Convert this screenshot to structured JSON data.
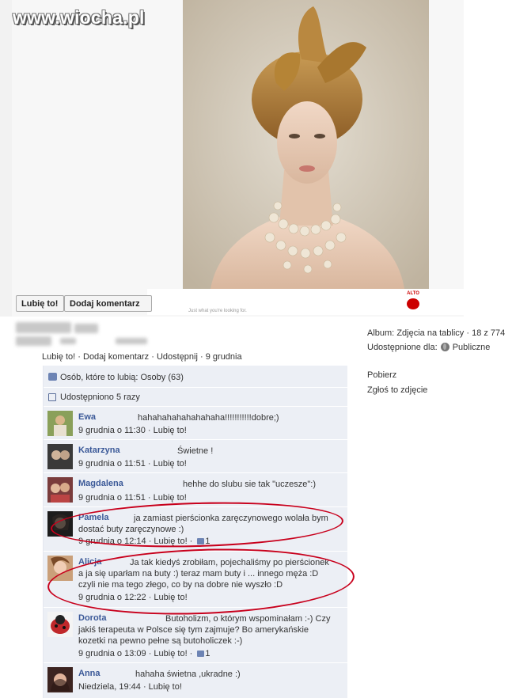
{
  "watermark": "www.wiocha.pl",
  "photo": {
    "tagline": "Just what you're looking for.",
    "brand": "ALTO"
  },
  "buttons": {
    "like": "Lubię to!",
    "comment": "Dodaj komentarz"
  },
  "actions": {
    "like": "Lubię to!",
    "comment": "Dodaj komentarz",
    "share": "Udostępnij",
    "date": "9 grudnia",
    "sep": "·"
  },
  "right": {
    "album_label": "Album:",
    "album_value": "Zdjęcia na tablicy · 18 z 774",
    "shared_label": "Udostępnione dla:",
    "shared_value": "Publiczne",
    "download": "Pobierz",
    "report": "Zgłoś to zdjęcie"
  },
  "likes_text": "Osób, które to lubią: Osoby (63)",
  "shares_text": "Udostępniono 5 razy",
  "comments": [
    {
      "name": "Ewa",
      "text": "hahahahahahahahaha!!!!!!!!!!!dobre;)",
      "date": "9 grudnia o 11:30",
      "like": "Lubię to!",
      "likes": ""
    },
    {
      "name": "Katarzyna",
      "text": "Świetne !",
      "date": "9 grudnia o 11:51",
      "like": "Lubię to!",
      "likes": ""
    },
    {
      "name": "Magdalena",
      "text": "hehhe do slubu sie tak \"uczesze\":)",
      "date": "9 grudnia o 11:51",
      "like": "Lubię to!",
      "likes": ""
    },
    {
      "name": "Pamela",
      "text": "ja zamiast pierścionka zaręczynowego wolała bym dostać buty zaręczynowe :)",
      "date": "9 grudnia o 12:14",
      "like": "Lubię to!",
      "likes": "1"
    },
    {
      "name": "Alicja",
      "text": "Ja tak kiedyś zrobiłam, pojechaliśmy po pierścionek a ja się uparłam na buty :) teraz mam buty i ... innego męża :D czyli nie ma tego złego, co by na dobre nie wyszło :D",
      "date": "9 grudnia o 12:22",
      "like": "Lubię to!",
      "likes": ""
    },
    {
      "name": "Dorota",
      "text": "Butoholizm, o którym wspominałam :-) Czy jakiś terapeuta w Polsce się tym zajmuje? Bo amerykańskie kozetki na pewno pełne są butoholiczek :-)",
      "date": "9 grudnia o 13:09",
      "like": "Lubię to!",
      "likes": "1"
    },
    {
      "name": "Anna",
      "text": "hahaha świetna ,ukradne :)",
      "date": "Niedziela, 19:44",
      "like": "Lubię to!",
      "likes": ""
    }
  ]
}
